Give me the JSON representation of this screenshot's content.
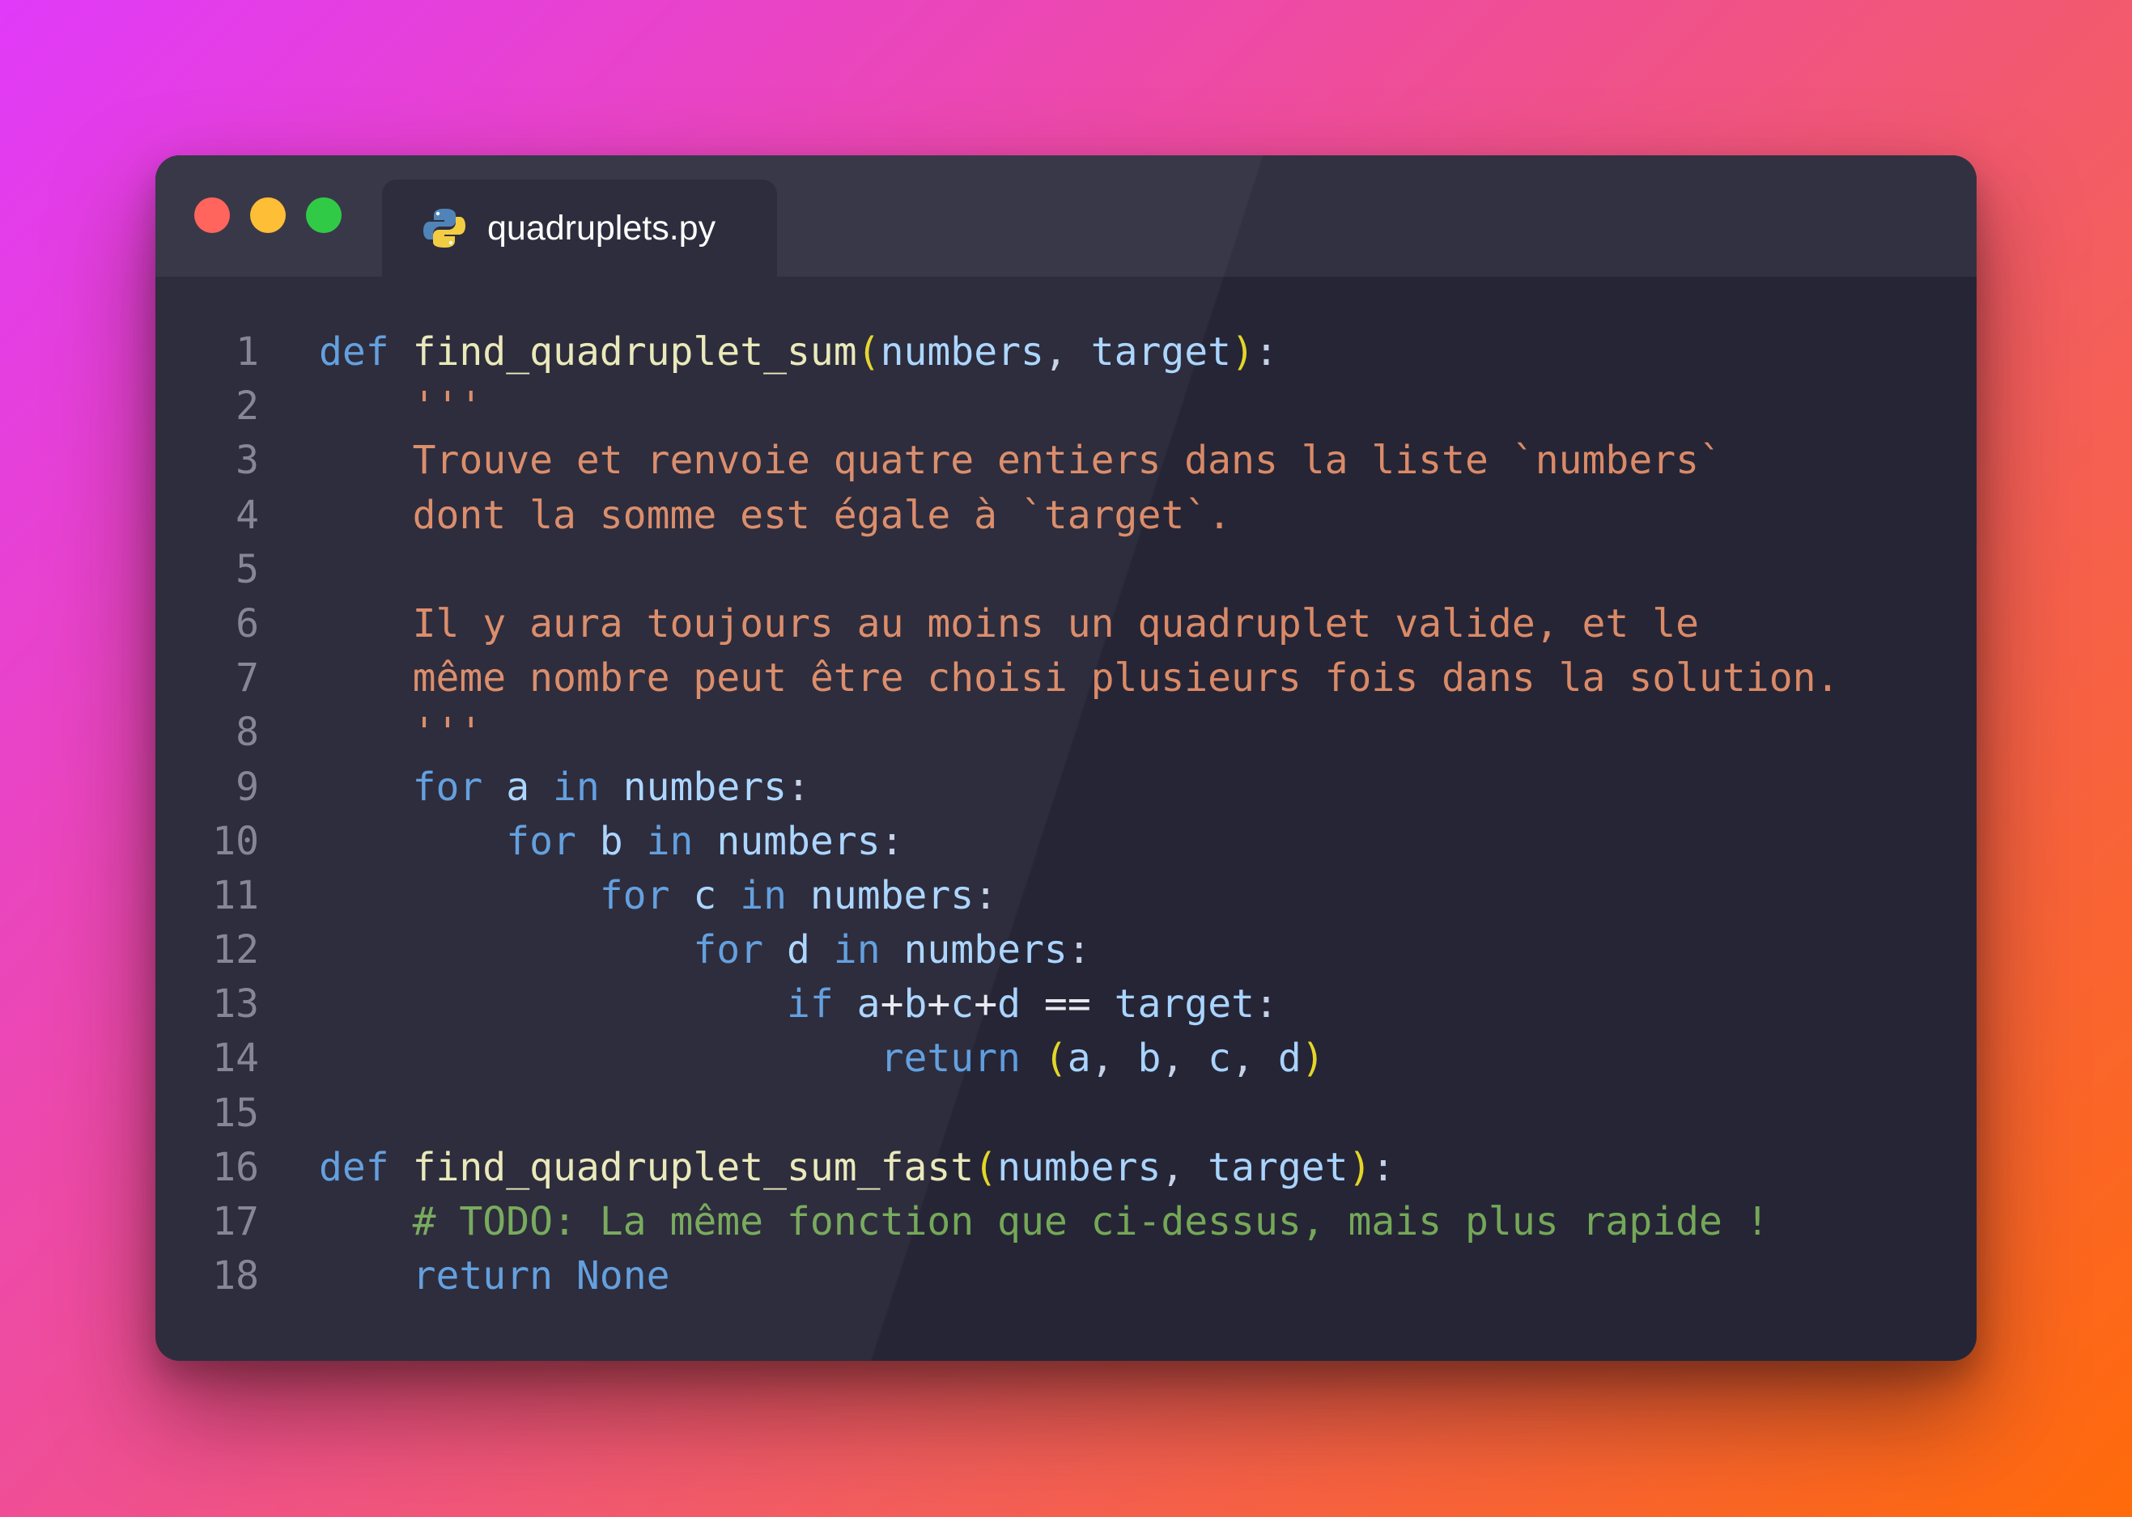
{
  "window": {
    "tab_title": "quadruplets.py",
    "tab_icon": "python-icon"
  },
  "colors": {
    "keyword": "#5e9dde",
    "function": "#e9e8b8",
    "identifier": "#a9d4ff",
    "paren": "#e3d628",
    "string": "#da8a67",
    "comment": "#74a858",
    "line_number": "#838291",
    "editor_bg": "#262536"
  },
  "code_lines": [
    {
      "n": "1",
      "tokens": [
        [
          "kw",
          "def"
        ],
        [
          "pun",
          " "
        ],
        [
          "fn",
          "find_quadruplet_sum"
        ],
        [
          "par",
          "("
        ],
        [
          "id",
          "numbers"
        ],
        [
          "pun",
          ", "
        ],
        [
          "id",
          "target"
        ],
        [
          "par",
          ")"
        ],
        [
          "pun",
          ":"
        ]
      ]
    },
    {
      "n": "2",
      "tokens": [
        [
          "pun",
          "    "
        ],
        [
          "str",
          "'''"
        ]
      ]
    },
    {
      "n": "3",
      "tokens": [
        [
          "pun",
          "    "
        ],
        [
          "str",
          "Trouve et renvoie quatre entiers dans la liste `numbers`"
        ]
      ]
    },
    {
      "n": "4",
      "tokens": [
        [
          "pun",
          "    "
        ],
        [
          "str",
          "dont la somme est égale à `target`."
        ]
      ]
    },
    {
      "n": "5",
      "tokens": []
    },
    {
      "n": "6",
      "tokens": [
        [
          "pun",
          "    "
        ],
        [
          "str",
          "Il y aura toujours au moins un quadruplet valide, et le"
        ]
      ]
    },
    {
      "n": "7",
      "tokens": [
        [
          "pun",
          "    "
        ],
        [
          "str",
          "même nombre peut être choisi plusieurs fois dans la solution."
        ]
      ]
    },
    {
      "n": "8",
      "tokens": [
        [
          "pun",
          "    "
        ],
        [
          "str",
          "'''"
        ]
      ]
    },
    {
      "n": "9",
      "tokens": [
        [
          "pun",
          "    "
        ],
        [
          "kw",
          "for"
        ],
        [
          "pun",
          " "
        ],
        [
          "id",
          "a"
        ],
        [
          "pun",
          " "
        ],
        [
          "kw",
          "in"
        ],
        [
          "pun",
          " "
        ],
        [
          "id",
          "numbers"
        ],
        [
          "pun",
          ":"
        ]
      ]
    },
    {
      "n": "10",
      "tokens": [
        [
          "pun",
          "        "
        ],
        [
          "kw",
          "for"
        ],
        [
          "pun",
          " "
        ],
        [
          "id",
          "b"
        ],
        [
          "pun",
          " "
        ],
        [
          "kw",
          "in"
        ],
        [
          "pun",
          " "
        ],
        [
          "id",
          "numbers"
        ],
        [
          "pun",
          ":"
        ]
      ]
    },
    {
      "n": "11",
      "tokens": [
        [
          "pun",
          "            "
        ],
        [
          "kw",
          "for"
        ],
        [
          "pun",
          " "
        ],
        [
          "id",
          "c"
        ],
        [
          "pun",
          " "
        ],
        [
          "kw",
          "in"
        ],
        [
          "pun",
          " "
        ],
        [
          "id",
          "numbers"
        ],
        [
          "pun",
          ":"
        ]
      ]
    },
    {
      "n": "12",
      "tokens": [
        [
          "pun",
          "                "
        ],
        [
          "kw",
          "for"
        ],
        [
          "pun",
          " "
        ],
        [
          "id",
          "d"
        ],
        [
          "pun",
          " "
        ],
        [
          "kw",
          "in"
        ],
        [
          "pun",
          " "
        ],
        [
          "id",
          "numbers"
        ],
        [
          "pun",
          ":"
        ]
      ]
    },
    {
      "n": "13",
      "tokens": [
        [
          "pun",
          "                    "
        ],
        [
          "kw",
          "if"
        ],
        [
          "pun",
          " "
        ],
        [
          "id",
          "a"
        ],
        [
          "op",
          "+"
        ],
        [
          "id",
          "b"
        ],
        [
          "op",
          "+"
        ],
        [
          "id",
          "c"
        ],
        [
          "op",
          "+"
        ],
        [
          "id",
          "d"
        ],
        [
          "pun",
          " "
        ],
        [
          "op",
          "=="
        ],
        [
          "pun",
          " "
        ],
        [
          "id",
          "target"
        ],
        [
          "pun",
          ":"
        ]
      ]
    },
    {
      "n": "14",
      "tokens": [
        [
          "pun",
          "                        "
        ],
        [
          "kw",
          "return"
        ],
        [
          "pun",
          " "
        ],
        [
          "par",
          "("
        ],
        [
          "id",
          "a"
        ],
        [
          "pun",
          ", "
        ],
        [
          "id",
          "b"
        ],
        [
          "pun",
          ", "
        ],
        [
          "id",
          "c"
        ],
        [
          "pun",
          ", "
        ],
        [
          "id",
          "d"
        ],
        [
          "par",
          ")"
        ]
      ]
    },
    {
      "n": "15",
      "tokens": []
    },
    {
      "n": "16",
      "tokens": [
        [
          "kw",
          "def"
        ],
        [
          "pun",
          " "
        ],
        [
          "fn",
          "find_quadruplet_sum_fast"
        ],
        [
          "par",
          "("
        ],
        [
          "id",
          "numbers"
        ],
        [
          "pun",
          ", "
        ],
        [
          "id",
          "target"
        ],
        [
          "par",
          ")"
        ],
        [
          "pun",
          ":"
        ]
      ]
    },
    {
      "n": "17",
      "tokens": [
        [
          "pun",
          "    "
        ],
        [
          "cmt",
          "# TODO: La même fonction que ci-dessus, mais plus rapide !"
        ]
      ]
    },
    {
      "n": "18",
      "tokens": [
        [
          "pun",
          "    "
        ],
        [
          "kw",
          "return"
        ],
        [
          "pun",
          " "
        ],
        [
          "kw",
          "None"
        ]
      ]
    }
  ]
}
